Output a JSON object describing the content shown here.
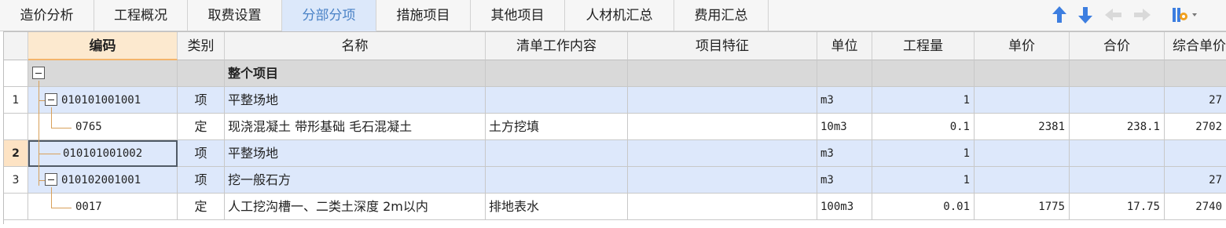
{
  "tabs": [
    {
      "label": "造价分析",
      "active": false
    },
    {
      "label": "工程概况",
      "active": false
    },
    {
      "label": "取费设置",
      "active": false
    },
    {
      "label": "分部分项",
      "active": true
    },
    {
      "label": "措施项目",
      "active": false
    },
    {
      "label": "其他项目",
      "active": false
    },
    {
      "label": "人材机汇总",
      "active": false
    },
    {
      "label": "费用汇总",
      "active": false
    }
  ],
  "toolbar": {
    "icons": [
      "arrow-up-icon",
      "arrow-down-icon",
      "arrow-left-icon",
      "arrow-right-icon",
      "column-settings-icon"
    ],
    "accent": "#3d7ee0"
  },
  "columns": {
    "code": "编码",
    "category": "类别",
    "name": "名称",
    "work_content": "清单工作内容",
    "feature": "项目特征",
    "unit": "单位",
    "quantity": "工程量",
    "unit_price": "单价",
    "total_price": "合价",
    "composite_unit_price": "综合单价"
  },
  "rows": [
    {
      "num": "",
      "code": "",
      "category": "",
      "name": "整个项目",
      "work_content": "",
      "feature": "",
      "unit": "",
      "quantity": "",
      "unit_price": "",
      "total_price": "",
      "composite": ""
    },
    {
      "num": "1",
      "code": "010101001001",
      "category": "项",
      "name": "平整场地",
      "work_content": "",
      "feature": "",
      "unit": "m3",
      "quantity": "1",
      "unit_price": "",
      "total_price": "",
      "composite": "27"
    },
    {
      "num": "",
      "code": "0765",
      "category": "定",
      "name": "现浇混凝土 带形基础 毛石混凝土",
      "work_content": "土方挖填",
      "feature": "",
      "unit": "10m3",
      "quantity": "0.1",
      "unit_price": "2381",
      "total_price": "238.1",
      "composite": "2702"
    },
    {
      "num": "2",
      "code": "010101001002",
      "category": "项",
      "name": "平整场地",
      "work_content": "",
      "feature": "",
      "unit": "m3",
      "quantity": "1",
      "unit_price": "",
      "total_price": "",
      "composite": ""
    },
    {
      "num": "3",
      "code": "010102001001",
      "category": "项",
      "name": "挖一般石方",
      "work_content": "",
      "feature": "",
      "unit": "m3",
      "quantity": "1",
      "unit_price": "",
      "total_price": "",
      "composite": "27"
    },
    {
      "num": "",
      "code": "0017",
      "category": "定",
      "name": "人工挖沟槽一、二类土深度 2m以内",
      "work_content": "排地表水",
      "feature": "",
      "unit": "100m3",
      "quantity": "0.01",
      "unit_price": "1775",
      "total_price": "17.75",
      "composite": "2740"
    }
  ]
}
